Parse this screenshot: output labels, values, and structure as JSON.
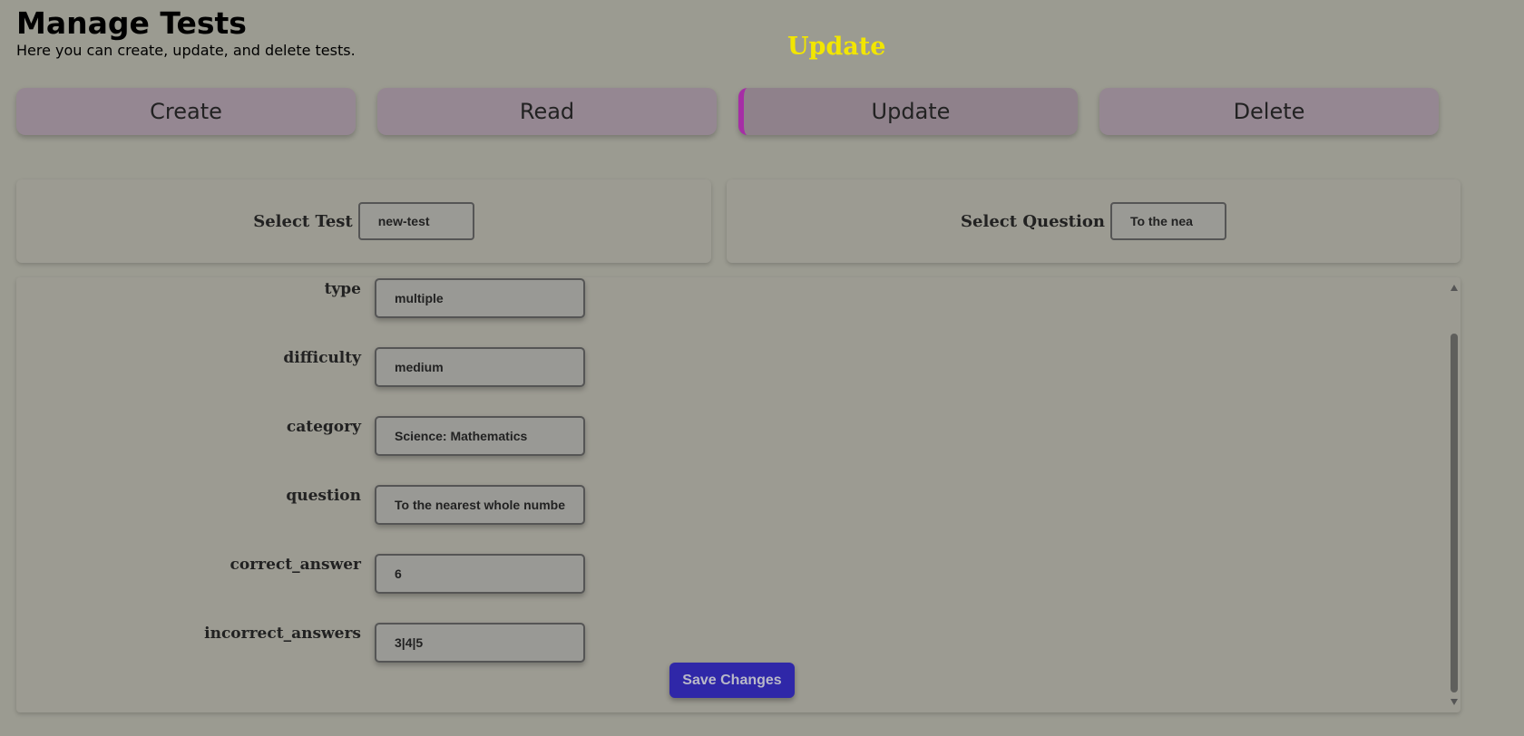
{
  "header": {
    "title": "Manage Tests",
    "subtitle": "Here you can create, update, and delete tests."
  },
  "mode_label": "Update",
  "tabs": [
    {
      "label": "Create"
    },
    {
      "label": "Read"
    },
    {
      "label": "Update"
    },
    {
      "label": "Delete"
    }
  ],
  "selectors": {
    "test": {
      "label": "Select Test",
      "value": "new-test"
    },
    "question": {
      "label": "Select Question",
      "value": "To the nea"
    }
  },
  "form": {
    "fields": [
      {
        "label": "type",
        "value": "multiple"
      },
      {
        "label": "difficulty",
        "value": "medium"
      },
      {
        "label": "category",
        "value": "Science: Mathematics"
      },
      {
        "label": "question",
        "value": "To the nearest whole numbe"
      },
      {
        "label": "correct_answer",
        "value": "6"
      },
      {
        "label": "incorrect_answers",
        "value": "3|4|5"
      }
    ],
    "save_label": "Save Changes"
  },
  "colors": {
    "background": "#9b9b91",
    "mode_label": "#f2e600",
    "tab_bg": "#958792",
    "tab_active_accent": "#a62ea6",
    "save_button": "#2f27a8"
  }
}
